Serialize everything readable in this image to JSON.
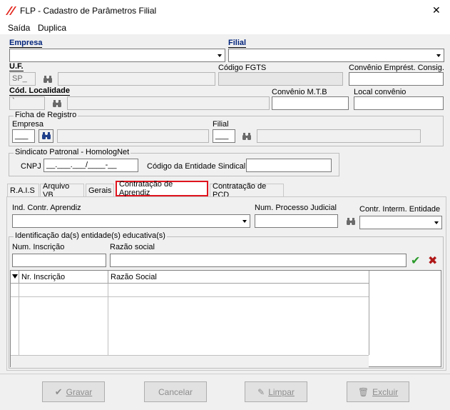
{
  "window": {
    "title": "FLP - Cadastro de Parâmetros Filial",
    "close_glyph": "✕"
  },
  "menu": {
    "items": [
      {
        "label": "Saída"
      },
      {
        "label": "Duplica"
      }
    ]
  },
  "header": {
    "empresa_label": "Empresa",
    "filial_label": "Filial",
    "uf_label": "U.F.",
    "uf_value": "SP_",
    "codigo_fgts_label": "Código FGTS",
    "convenio_emprest_label": "Convênio Emprést. Consig.",
    "cod_localidade_label": "Cód. Localidade",
    "cod_localidade_value": "`",
    "convenio_mtb_label": "Convênio M.T.B",
    "local_convenio_label": "Local convênio"
  },
  "ficha": {
    "title": "Ficha de Registro",
    "empresa_label": "Empresa",
    "empresa_value": "___",
    "filial_label": "Filial",
    "filial_value": "___"
  },
  "sindicato": {
    "title": "Sindicato Patronal - HomologNet",
    "cnpj_label": "CNPJ",
    "cnpj_value": "__.___.___/____-__",
    "codigo_label": "Código da Entidade Sindical"
  },
  "tabs": [
    {
      "label": "R.A.I.S"
    },
    {
      "label": "Arquivo VB"
    },
    {
      "label": "Gerais"
    },
    {
      "label": "Contratação de Aprendiz"
    },
    {
      "label": "Contratação de PCD"
    }
  ],
  "aprendiz": {
    "ind_contr_label": "Ind. Contr. Aprendiz",
    "num_processo_label": "Num. Processo Judicial",
    "contr_interm_label": "Contr. Interm. Entidade",
    "entidades_title": "Identificação da(s) entidade(s) educativa(s)",
    "num_inscricao_label": "Num. Inscrição",
    "razao_social_label": "Razão social",
    "confirm_glyph": "✔",
    "cancel_glyph": "✖",
    "grid": {
      "columns": [
        "Nr. Inscrição",
        "Razão Social"
      ]
    }
  },
  "buttons": {
    "gravar": "Gravar",
    "cancelar": "Cancelar",
    "limpar": "Limpar",
    "excluir": "Excluir"
  },
  "colors": {
    "accent": "#00237a",
    "active_tab_border": "#e0141e",
    "check": "#2a9a2a",
    "cross": "#b01818"
  }
}
